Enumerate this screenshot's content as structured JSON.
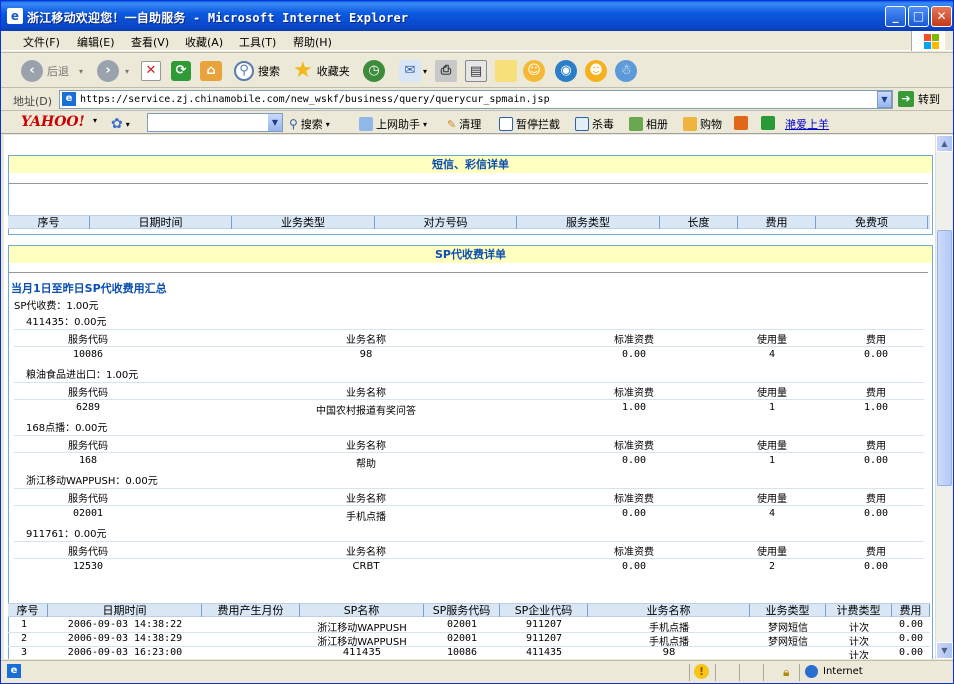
{
  "window": {
    "title": "浙江移动欢迎您！一自助服务 - Microsoft Internet Explorer"
  },
  "menu": [
    "文件(F)",
    "编辑(E)",
    "查看(V)",
    "收藏(A)",
    "工具(T)",
    "帮助(H)"
  ],
  "toolbar": {
    "back": "后退",
    "search": "搜索",
    "favorites": "收藏夹"
  },
  "address": {
    "label": "地址(D)",
    "url": "https://service.zj.chinamobile.com/new_wskf/business/query/querycur_spmain.jsp",
    "go": "转到"
  },
  "yahoo": {
    "logo": "YAHOO!",
    "search": "搜索",
    "assistant": "上网助手",
    "clean": "清理",
    "popup": "暂停拦截",
    "antivirus": "杀毒",
    "album": "相册",
    "shopping": "购物",
    "love": "滟爱上羊"
  },
  "sms": {
    "header": "短信、彩信详单",
    "columns": [
      "序号",
      "日期时间",
      "业务类型",
      "对方号码",
      "服务类型",
      "长度",
      "费用",
      "免费项"
    ]
  },
  "sp": {
    "header": "SP代收费详单",
    "summary_title": "当月1日至昨日SP代收费用汇总",
    "total": "SP代收费：1.00元",
    "columns": [
      "服务代码",
      "业务名称",
      "标准资费",
      "使用量",
      "费用"
    ],
    "groups": [
      {
        "name": "411435：0.00元",
        "code": "10086",
        "service": "98",
        "rate": "0.00",
        "usage": "4",
        "fee": "0.00"
      },
      {
        "name": "粮油食品进出口：1.00元",
        "code": "6289",
        "service": "中国农村报道有奖问答",
        "rate": "1.00",
        "usage": "1",
        "fee": "1.00"
      },
      {
        "name": "168点播：0.00元",
        "code": "168",
        "service": "帮助",
        "rate": "0.00",
        "usage": "1",
        "fee": "0.00"
      },
      {
        "name": "浙江移动WAPPUSH：0.00元",
        "code": "02001",
        "service": "手机点播",
        "rate": "0.00",
        "usage": "4",
        "fee": "0.00"
      },
      {
        "name": "911761：0.00元",
        "code": "12530",
        "service": "CRBT",
        "rate": "0.00",
        "usage": "2",
        "fee": "0.00"
      }
    ],
    "detail_columns": [
      "序号",
      "日期时间",
      "费用产生月份",
      "SP名称",
      "SP服务代码",
      "SP企业代码",
      "业务名称",
      "业务类型",
      "计费类型",
      "费用"
    ],
    "details": [
      {
        "no": "1",
        "time": "2006-09-03 14:38:22",
        "month": "",
        "sp": "浙江移动WAPPUSH",
        "sp_code": "02001",
        "ent_code": "911207",
        "service": "手机点播",
        "type": "梦网短信",
        "billing": "计次",
        "fee": "0.00"
      },
      {
        "no": "2",
        "time": "2006-09-03 14:38:29",
        "month": "",
        "sp": "浙江移动WAPPUSH",
        "sp_code": "02001",
        "ent_code": "911207",
        "service": "手机点播",
        "type": "梦网短信",
        "billing": "计次",
        "fee": "0.00"
      },
      {
        "no": "3",
        "time": "2006-09-03 16:23:00",
        "month": "",
        "sp": "411435",
        "sp_code": "10086",
        "ent_code": "411435",
        "service": "98",
        "type": "",
        "billing": "计次",
        "fee": "0.00"
      }
    ]
  },
  "status": {
    "zone": "Internet"
  },
  "colors": {
    "title_bar": "#0845c8",
    "panel_header_bg": "#ffffc0",
    "panel_header_text": "#0b4fb1",
    "table_header_bg": "#d9e6f4"
  }
}
